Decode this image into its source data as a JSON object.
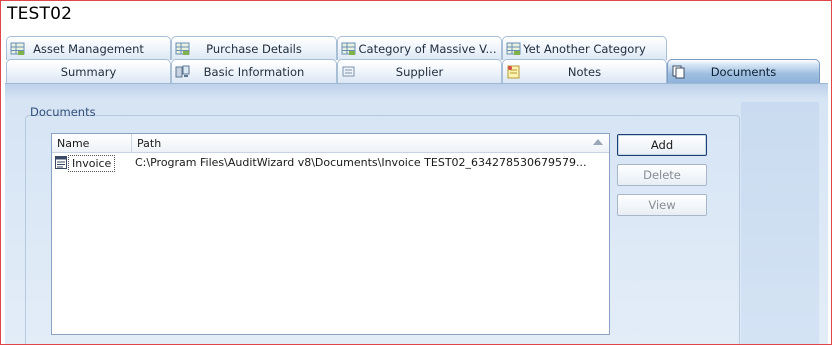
{
  "window": {
    "title": "TEST02"
  },
  "tabs_row1": [
    {
      "label": "Asset Management",
      "icon": "grid-icon"
    },
    {
      "label": "Purchase Details",
      "icon": "grid-icon"
    },
    {
      "label": "Category of Massive V...",
      "icon": "grid-icon"
    },
    {
      "label": "Yet Another Category",
      "icon": "grid-icon"
    }
  ],
  "tabs_row2": [
    {
      "label": "Summary"
    },
    {
      "label": "Basic Information",
      "icon": "computer-icon"
    },
    {
      "label": "Supplier",
      "icon": "supplier-icon"
    },
    {
      "label": "Notes",
      "icon": "notes-icon"
    },
    {
      "label": "Documents",
      "icon": "documents-icon",
      "active": true
    }
  ],
  "documents": {
    "group_label": "Documents",
    "columns": {
      "name": "Name",
      "path": "Path"
    },
    "rows": [
      {
        "name": "Invoice",
        "path": "C:\\Program Files\\AuditWizard v8\\Documents\\Invoice TEST02_634278530679579..."
      }
    ],
    "buttons": {
      "add": "Add",
      "delete": "Delete",
      "view": "View"
    }
  },
  "colors": {
    "frame_border": "#e0454a",
    "active_tab": "#8db2d9",
    "panel_bg": "#d6e4f4"
  }
}
